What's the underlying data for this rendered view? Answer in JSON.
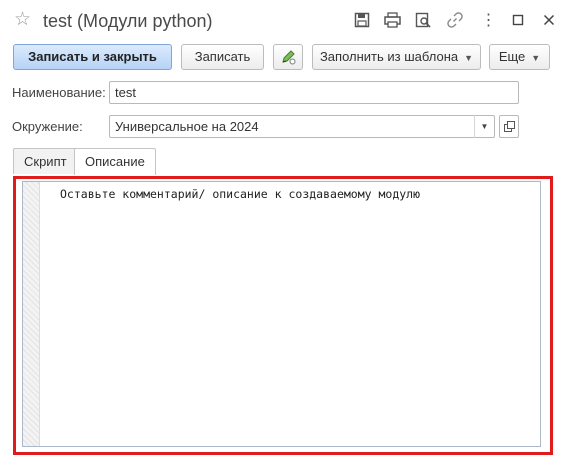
{
  "window": {
    "title": "test (Модули python)",
    "icons": [
      "star-icon",
      "save-icon",
      "print-icon",
      "preview-icon",
      "link-icon",
      "more-icon",
      "maximize-icon",
      "close-icon"
    ]
  },
  "toolbar": {
    "save_close_label": "Записать и закрыть",
    "save_label": "Записать",
    "fill_template_label": "Заполнить из шаблона",
    "more_label": "Еще"
  },
  "form": {
    "name_label": "Наименование:",
    "name_value": "test",
    "env_label": "Окружение:",
    "env_value": "Универсальное на 2024"
  },
  "tabs": [
    {
      "label": "Скрипт",
      "active": false
    },
    {
      "label": "Описание",
      "active": true
    }
  ],
  "editor": {
    "text": "Оставьте комментарий/ описание к создаваемому модулю"
  },
  "colors": {
    "highlight": "#e01b1b",
    "primary_button": "#b6d3f6"
  }
}
